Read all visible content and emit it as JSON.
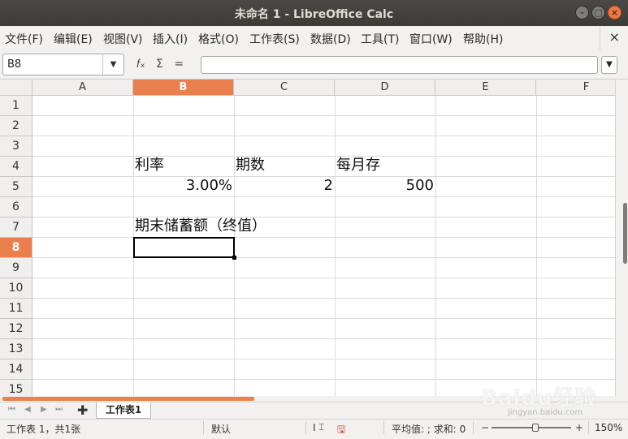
{
  "window": {
    "title": "未命名 1 - LibreOffice Calc"
  },
  "menu": [
    "文件(F)",
    "编辑(E)",
    "视图(V)",
    "插入(I)",
    "格式(O)",
    "工作表(S)",
    "数据(D)",
    "工具(T)",
    "窗口(W)",
    "帮助(H)"
  ],
  "formula_bar": {
    "cell_ref": "B8",
    "fx_icon": "fx-icon",
    "sum_icon": "sum-icon",
    "equals_icon": "equals-icon",
    "content": ""
  },
  "columns": [
    "A",
    "B",
    "C",
    "D",
    "E",
    "F"
  ],
  "rows": [
    "1",
    "2",
    "3",
    "4",
    "5",
    "6",
    "7",
    "8",
    "9",
    "10",
    "11",
    "12",
    "13",
    "14",
    "15"
  ],
  "selected": {
    "column": "B",
    "row": "8"
  },
  "cells": {
    "B4": "利率",
    "C4": "期数",
    "D4": "每月存",
    "B5": "3.00%",
    "C5": "2",
    "D5": "500",
    "B7": "期末储蓄额（终值）"
  },
  "sheet_tabs": [
    "工作表1"
  ],
  "status": {
    "sheet_info": "工作表 1，共1张",
    "page_style": "默认",
    "insert_mode": "I",
    "summary": "平均值: ; 求和: 0",
    "zoom_minus": "−",
    "zoom_plus": "+",
    "zoom": "150%"
  },
  "watermark": {
    "text": "Baidu经验",
    "sub": "jingyan.baidu.com"
  },
  "colors": {
    "accent": "#e9804d",
    "titlebar": "#3c3b37",
    "close": "#f07746"
  }
}
